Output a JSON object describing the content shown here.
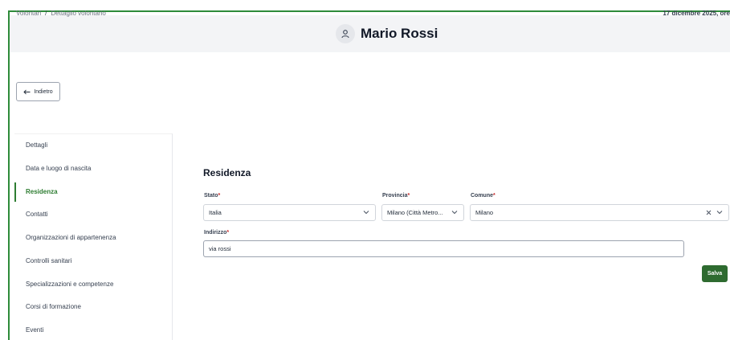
{
  "breadcrumb": {
    "parent": "Volontari",
    "separator": "/",
    "current": "Dettaglio volontario"
  },
  "date_text": "17 dicembre 2025, ore",
  "header": {
    "title": "Mario Rossi",
    "icon": "user-icon"
  },
  "back_button": {
    "label": "Indietro",
    "icon": "arrow-left-icon"
  },
  "sidebar": {
    "items": [
      {
        "label": "Dettagli"
      },
      {
        "label": "Data e luogo di nascita"
      },
      {
        "label": "Residenza",
        "active": true
      },
      {
        "label": "Contatti"
      },
      {
        "label": "Organizzazioni di appartenenza"
      },
      {
        "label": "Controlli sanitari"
      },
      {
        "label": "Specializzazioni e competenze"
      },
      {
        "label": "Corsi di formazione"
      },
      {
        "label": "Eventi"
      }
    ]
  },
  "form": {
    "section_title": "Residenza",
    "required_marker": "*",
    "stato": {
      "label": "Stato",
      "value": "Italia"
    },
    "provincia": {
      "label": "Provincia",
      "value": "Milano (Città Metro..."
    },
    "comune": {
      "label": "Comune",
      "value": "Milano"
    },
    "indirizzo": {
      "label": "Indirizzo",
      "value": "via rossi"
    },
    "save_label": "Salva"
  },
  "colors": {
    "accent": "#2e7d32",
    "save_button": "#2e6b30",
    "required": "#c62828",
    "header_bg": "#f3f4f6"
  }
}
